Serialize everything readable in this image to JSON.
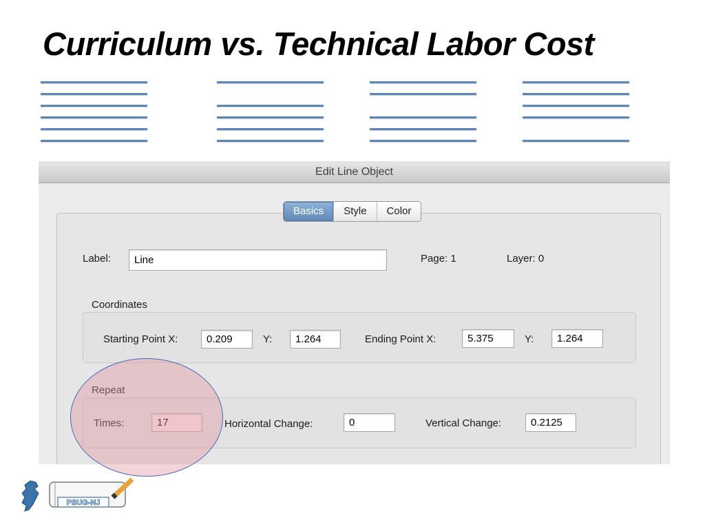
{
  "slide": {
    "title": "Curriculum vs. Technical Labor Cost"
  },
  "dialog": {
    "title": "Edit Line Object",
    "tabs": [
      {
        "label": "Basics",
        "selected": true
      },
      {
        "label": "Style",
        "selected": false
      },
      {
        "label": "Color",
        "selected": false
      }
    ],
    "label_caption": "Label:",
    "label_value": "Line",
    "page_text": "Page: 1",
    "layer_text": "Layer: 0",
    "coordinates": {
      "title": "Coordinates",
      "start_x_caption": "Starting Point X:",
      "start_x": "0.209",
      "start_y_caption": "Y:",
      "start_y": "1.264",
      "end_x_caption": "Ending Point X:",
      "end_x": "5.375",
      "end_y_caption": "Y:",
      "end_y": "1.264"
    },
    "repeat": {
      "title": "Repeat",
      "times_caption": "Times:",
      "times": "17",
      "horizontal_caption": "Horizontal Change:",
      "horizontal": "0",
      "vertical_caption": "Vertical Change:",
      "vertical": "0.2125"
    }
  },
  "logo": {
    "text": "PSUG-NJ"
  },
  "colors": {
    "line": "#5a86b8",
    "tab_selected": "#6f97c4",
    "highlight": "#e196a0",
    "highlight_border": "#4a68b8"
  }
}
